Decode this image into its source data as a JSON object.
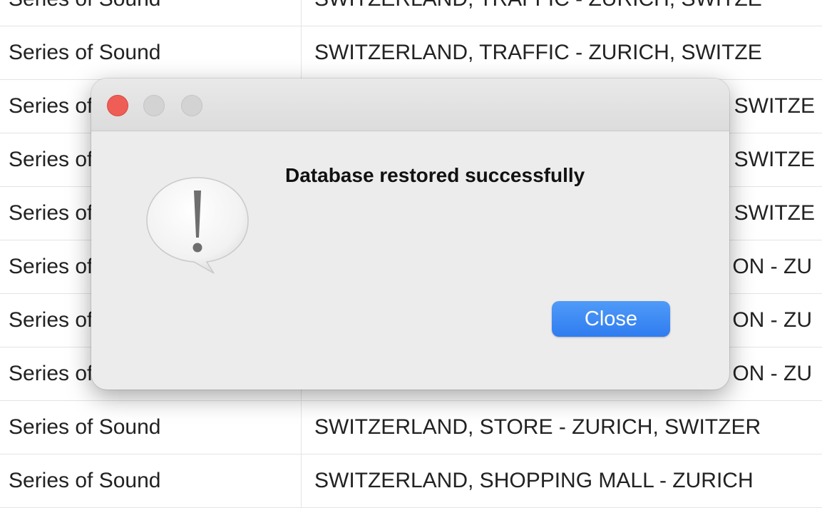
{
  "table": {
    "rows": [
      {
        "series": "Series of Sound",
        "description": "SWITZERLAND, TRAFFIC - ZURICH, SWITZE"
      },
      {
        "series": "Series of Sound",
        "description": "SWITZERLAND, TRAFFIC - ZURICH, SWITZE"
      },
      {
        "series": "Series of Sound",
        "description": "SWITZE"
      },
      {
        "series": "Series of Sound",
        "description": "SWITZE"
      },
      {
        "series": "Series of Sound",
        "description": "SWITZE"
      },
      {
        "series": "Series of Sound",
        "description": "ON - ZU"
      },
      {
        "series": "Series of Sound",
        "description": "ON - ZU"
      },
      {
        "series": "Series of Sound",
        "description": "ON - ZU"
      },
      {
        "series": "Series of Sound",
        "description": "SWITZERLAND, STORE - ZURICH, SWITZER"
      },
      {
        "series": "Series of Sound",
        "description": "SWITZERLAND, SHOPPING MALL - ZURICH"
      }
    ]
  },
  "dialog": {
    "message": "Database restored successfully",
    "close_label": "Close",
    "icon": "alert-caution-icon"
  },
  "colors": {
    "close_dot": "#ee5e57",
    "inactive_dot": "#d3d3d3",
    "accent_button": "#3a86f3",
    "dialog_bg": "#ececec"
  }
}
